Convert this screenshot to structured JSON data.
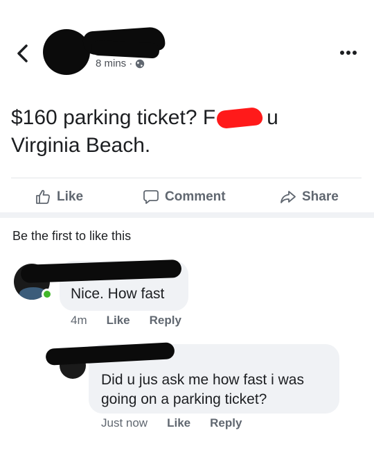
{
  "post": {
    "timestamp": "8 mins ·",
    "text_before": "$160 parking ticket? F",
    "text_after": "u",
    "text_line2": "Virginia Beach."
  },
  "actions": {
    "like": "Like",
    "comment": "Comment",
    "share": "Share"
  },
  "likes_summary": "Be the first to like this",
  "comments": [
    {
      "text": "Nice. How fast",
      "time": "4m",
      "like": "Like",
      "reply": "Reply",
      "online": true
    },
    {
      "text_line1": "Did u jus ask me how fast i was",
      "text_line2": "going on a parking ticket?",
      "time": "Just now",
      "like": "Like",
      "reply": "Reply"
    }
  ],
  "colors": {
    "online_dot": "#42b72a",
    "censor": "#ff1a1a",
    "bubble": "#f0f2f5"
  }
}
